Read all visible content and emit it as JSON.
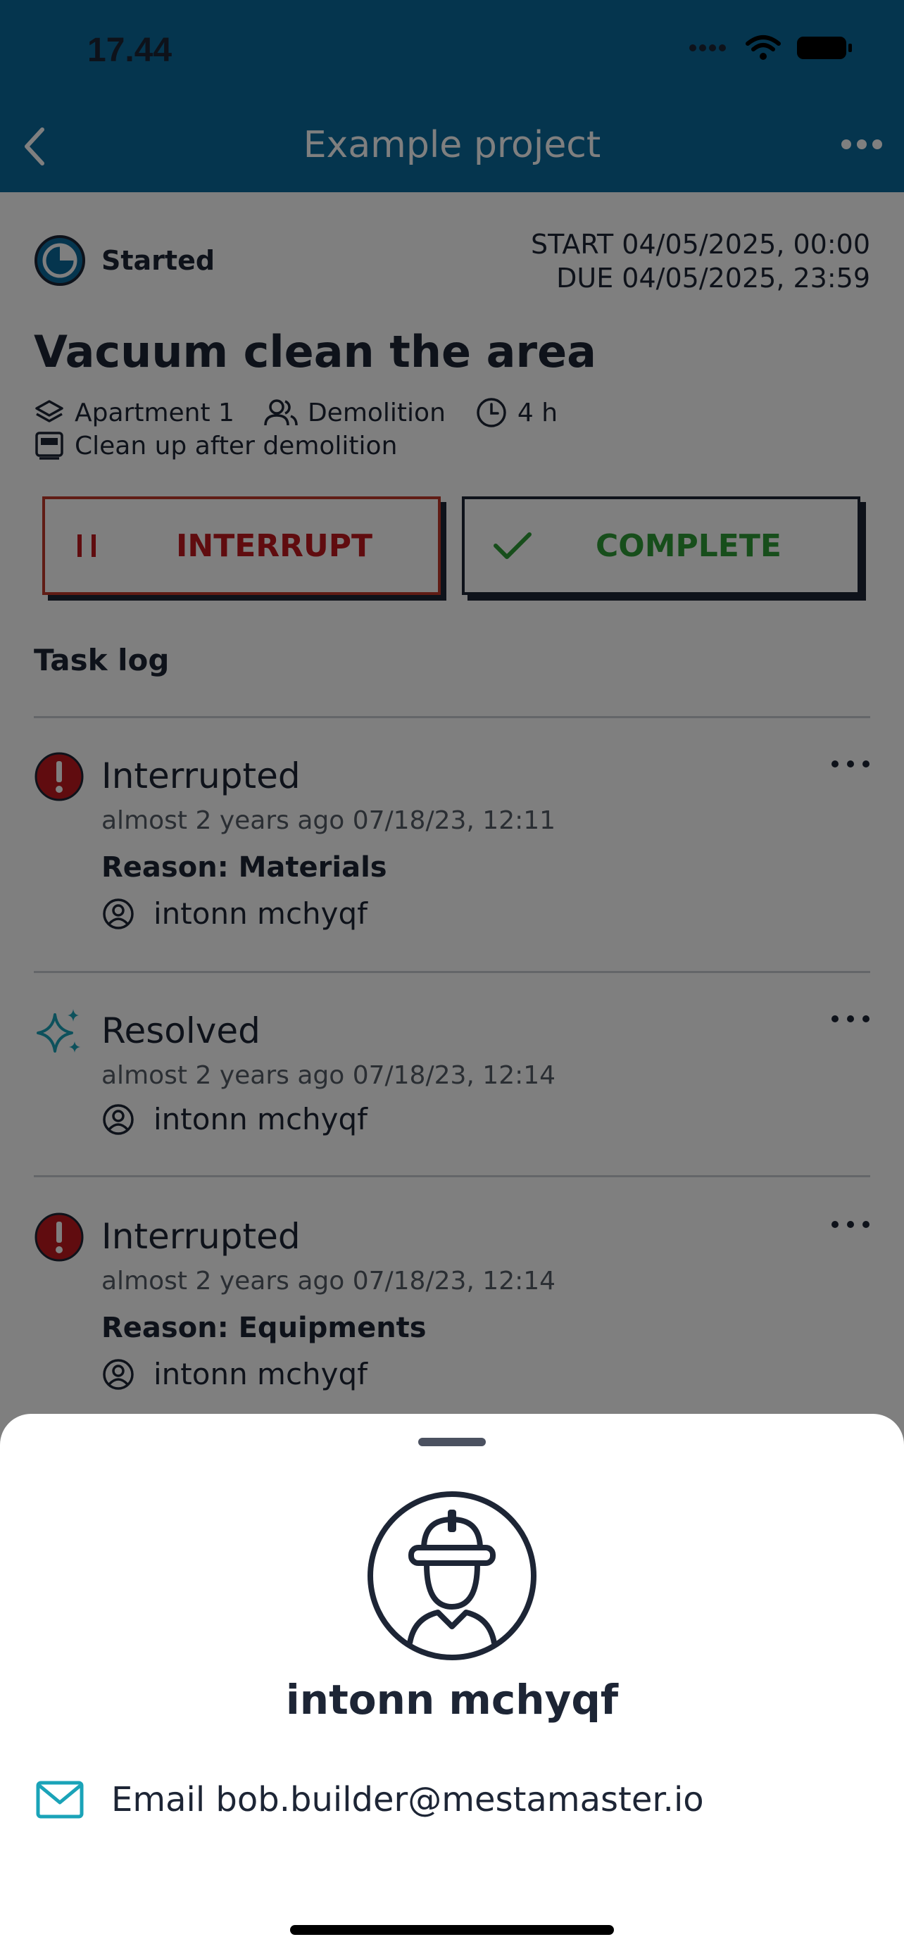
{
  "status_bar": {
    "time": "17.44"
  },
  "nav": {
    "title": "Example project"
  },
  "task": {
    "state": "Started",
    "start": "START 04/05/2025, 00:00",
    "due": "DUE 04/05/2025, 23:59",
    "title": "Vacuum clean the area",
    "location": "Apartment 1",
    "team": "Demolition",
    "duration": "4 h",
    "description": "Clean up after demolition"
  },
  "actions": {
    "interrupt_label": "INTERRUPT",
    "complete_label": "COMPLETE"
  },
  "task_log": {
    "title": "Task log",
    "entries": [
      {
        "type": "Interrupted",
        "time": "almost 2 years ago 07/18/23, 12:11",
        "reason": "Reason: Materials",
        "user": "intonn mchyqf"
      },
      {
        "type": "Resolved",
        "time": "almost 2 years ago 07/18/23, 12:14",
        "user": "intonn mchyqf"
      },
      {
        "type": "Interrupted",
        "time": "almost 2 years ago 07/18/23, 12:14",
        "reason": "Reason: Equipments",
        "user": "intonn mchyqf"
      }
    ]
  },
  "sheet": {
    "name": "intonn mchyqf",
    "email_label": "Email bob.builder@mestamaster.io"
  },
  "colors": {
    "header": "#0b6a9d",
    "navy": "#1d2535",
    "interrupt_red": "#c0191f",
    "complete_green": "#2f9d36",
    "resolved_teal": "#1aa3b8",
    "email_icon": "#1aa3b8"
  },
  "icons": [
    "chevron-left-icon",
    "more-horizontal-icon",
    "started-clock-icon",
    "layers-icon",
    "users-icon",
    "clock-icon",
    "board-icon",
    "pause-icon",
    "check-icon",
    "alert-circle-icon",
    "sparkles-icon",
    "user-circle-icon",
    "worker-avatar-icon",
    "mail-icon"
  ]
}
